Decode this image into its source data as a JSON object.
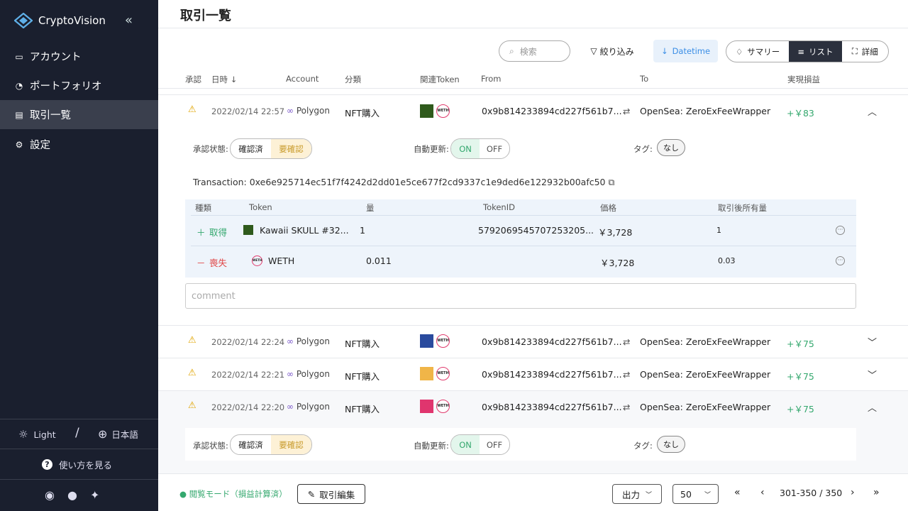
{
  "app": {
    "name": "CryptoVision"
  },
  "nav": [
    {
      "label": "アカウント"
    },
    {
      "label": "ポートフォリオ"
    },
    {
      "label": "取引一覧"
    },
    {
      "label": "設定"
    }
  ],
  "sidebar_footer": {
    "theme": "Light",
    "separator": "/",
    "language": "日本語",
    "help": "使い方を見る"
  },
  "page": {
    "title": "取引一覧"
  },
  "toolbar": {
    "search_placeholder": "検索",
    "filter": "絞り込み",
    "sort": "Datetime",
    "views": [
      "サマリー",
      "リスト",
      "詳細"
    ],
    "active_view": "リスト"
  },
  "table": {
    "headers": {
      "approve": "承認",
      "datetime": "日時",
      "account": "Account",
      "category": "分類",
      "tokens": "関連Token",
      "from": "From",
      "to": "To",
      "pnl": "実現損益"
    }
  },
  "rows": [
    {
      "date": "2022/02/14 22:57",
      "account": "Polygon",
      "category": "NFT購入",
      "from": "0x9b814233894cd227f561b7...",
      "to": "OpenSea: ZeroExFeeWrapper",
      "pnl": "+￥83"
    },
    {
      "date": "2022/02/14 22:24",
      "account": "Polygon",
      "category": "NFT購入",
      "from": "0x9b814233894cd227f561b7...",
      "to": "OpenSea: ZeroExFeeWrapper",
      "pnl": "+￥75"
    },
    {
      "date": "2022/02/14 22:21",
      "account": "Polygon",
      "category": "NFT購入",
      "from": "0x9b814233894cd227f561b7...",
      "to": "OpenSea: ZeroExFeeWrapper",
      "pnl": "+￥75"
    },
    {
      "date": "2022/02/14 22:20",
      "account": "Polygon",
      "category": "NFT購入",
      "from": "0x9b814233894cd227f561b7...",
      "to": "OpenSea: ZeroExFeeWrapper",
      "pnl": "+￥75"
    }
  ],
  "detail": {
    "approval_label": "承認状態:",
    "approval_options": [
      "確認済",
      "要確認"
    ],
    "approval_selected": "要確認",
    "autoupdate_label": "自動更新:",
    "autoupdate_options": [
      "ON",
      "OFF"
    ],
    "autoupdate_selected": "ON",
    "tag_label": "タグ:",
    "tag_value": "なし",
    "transaction_label": "Transaction: 0xe6e925714ec51f7f4242d2dd01e5ce677f2cd9337c1e9ded6e122932b00afc50",
    "sub_headers": {
      "kind": "種類",
      "token": "Token",
      "amount": "量",
      "tokenid": "TokenID",
      "price": "価格",
      "holding": "取引後所有量"
    },
    "sub_rows": [
      {
        "sign": "＋",
        "kind": "取得",
        "token": "Kawaii SKULL #32...",
        "amount": "1",
        "tokenid": "5792069545707253205...",
        "price": "￥3,728",
        "holding": "1"
      },
      {
        "sign": "－",
        "kind": "喪失",
        "token": "WETH",
        "amount": "0.011",
        "tokenid": "",
        "price": "￥3,728",
        "holding": "0.03"
      }
    ],
    "comment_placeholder": "comment"
  },
  "weth_label": "WETH",
  "footer": {
    "mode": "閲覧モード（損益計算済）",
    "edit": "取引編集",
    "export": "出力",
    "page_size": "50",
    "range": "301-350 / 350"
  },
  "colors": {
    "sidebar": "#1a1f2e",
    "active_nav": "#3a3f4d",
    "gain": "#34a86e",
    "warning": "#e0a400",
    "polygon": "#7855c8",
    "loss": "#e04848",
    "accent_blue": "#3a8ee6"
  }
}
